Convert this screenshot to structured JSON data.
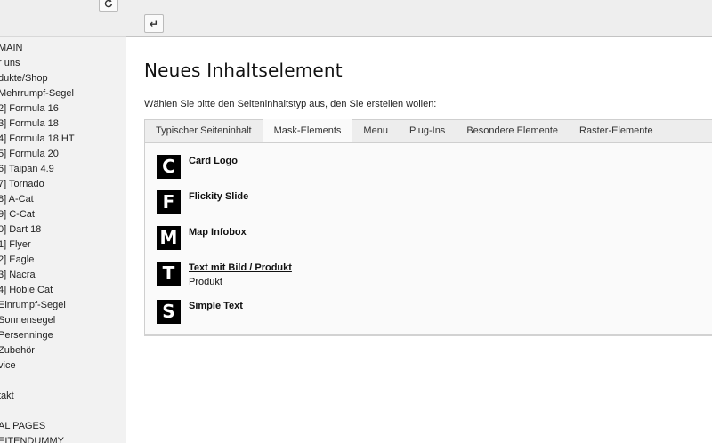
{
  "tree": {
    "items": [
      "MAIN",
      "r uns",
      "dukte/Shop",
      "Mehrrumpf-Segel",
      "2] Formula 16",
      "3] Formula 18",
      "4] Formula 18 HT",
      "5] Formula 20",
      "6] Taipan 4.9",
      "7] Tornado",
      "8] A-Cat",
      "9] C-Cat",
      "0] Dart 18",
      "1] Flyer",
      "2] Eagle",
      "3] Nacra",
      "4] Hobie Cat",
      "Einrumpf-Segel",
      "Sonnensegel",
      "Persenninge",
      "Zubehör",
      "vice",
      "",
      "takt",
      "",
      "AL PAGES",
      "EITENDUMMY"
    ],
    "refresh_icon": "refresh-icon"
  },
  "header": {
    "back_icon": "↵"
  },
  "page": {
    "title": "Neues Inhaltselement",
    "description": "Wählen Sie bitte den Seiteninhaltstyp aus, den Sie erstellen wollen:"
  },
  "tabs": [
    "Typischer Seiteninhalt",
    "Mask-Elements",
    "Menu",
    "Plug-Ins",
    "Besondere Elemente",
    "Raster-Elemente"
  ],
  "active_tab": "Mask-Elements",
  "elements": [
    {
      "icon": "C",
      "title": "Card Logo",
      "subtitle": ""
    },
    {
      "icon": "F",
      "title": "Flickity Slide",
      "subtitle": ""
    },
    {
      "icon": "M",
      "title": "Map Infobox",
      "subtitle": ""
    },
    {
      "icon": "T",
      "title": "Text mit Bild / Produkt",
      "subtitle": "Produkt"
    },
    {
      "icon": "S",
      "title": "Simple Text",
      "subtitle": ""
    }
  ],
  "colors": {
    "icon_bg": "#000000",
    "panel_bg": "#fafafa",
    "header_bg": "#eeeeee"
  }
}
